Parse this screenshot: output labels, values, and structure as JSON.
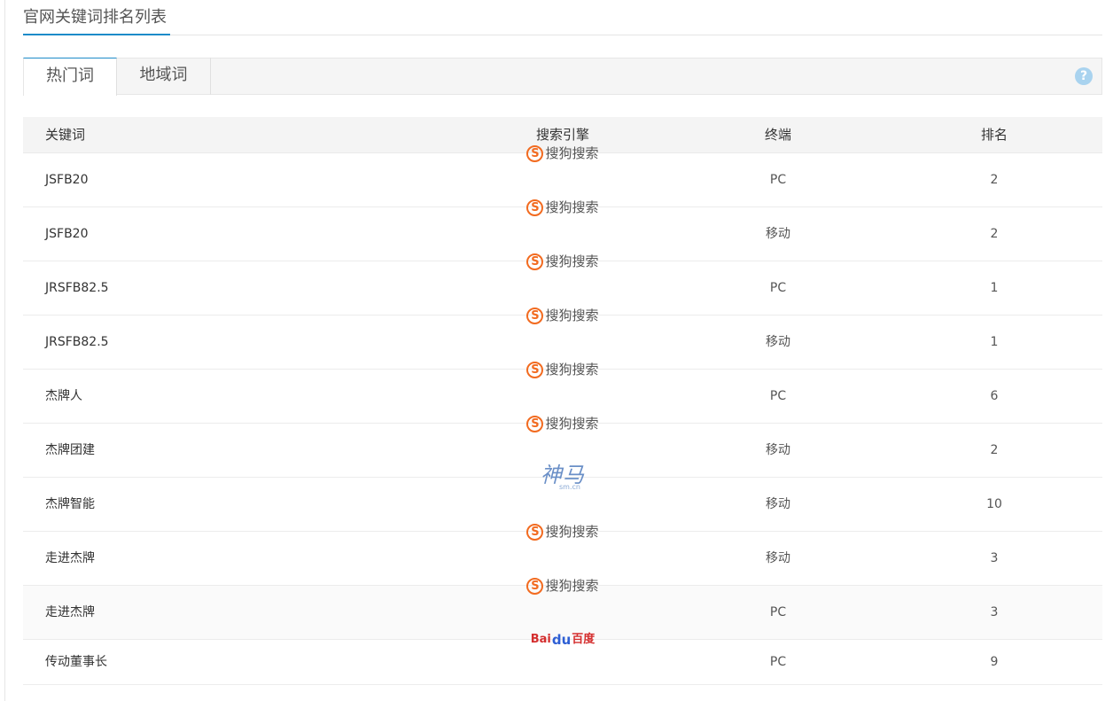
{
  "header": {
    "title": "官网关键词排名列表"
  },
  "tabs": [
    {
      "label": "热门词",
      "active": true
    },
    {
      "label": "地域词",
      "active": false
    }
  ],
  "help": {
    "glyph": "?"
  },
  "table": {
    "columns": [
      "关键词",
      "搜索引擎",
      "终端",
      "排名"
    ],
    "rows": [
      {
        "keyword": "JSFB20",
        "engine": "sogou",
        "engine_label": "搜狗搜索",
        "terminal": "PC",
        "rank": "2"
      },
      {
        "keyword": "JSFB20",
        "engine": "sogou",
        "engine_label": "搜狗搜索",
        "terminal": "移动",
        "rank": "2"
      },
      {
        "keyword": "JRSFB82.5",
        "engine": "sogou",
        "engine_label": "搜狗搜索",
        "terminal": "PC",
        "rank": "1"
      },
      {
        "keyword": "JRSFB82.5",
        "engine": "sogou",
        "engine_label": "搜狗搜索",
        "terminal": "移动",
        "rank": "1"
      },
      {
        "keyword": "杰牌人",
        "engine": "sogou",
        "engine_label": "搜狗搜索",
        "terminal": "PC",
        "rank": "6"
      },
      {
        "keyword": "杰牌团建",
        "engine": "sogou",
        "engine_label": "搜狗搜索",
        "terminal": "移动",
        "rank": "2"
      },
      {
        "keyword": "杰牌智能",
        "engine": "shenma",
        "engine_label": "神马",
        "engine_sub": "sm.cn",
        "terminal": "移动",
        "rank": "10"
      },
      {
        "keyword": "走进杰牌",
        "engine": "sogou",
        "engine_label": "搜狗搜索",
        "terminal": "移动",
        "rank": "3"
      },
      {
        "keyword": "走进杰牌",
        "engine": "sogou",
        "engine_label": "搜狗搜索",
        "terminal": "PC",
        "rank": "3"
      },
      {
        "keyword": "传动董事长",
        "engine": "baidu",
        "engine_label": "Bai百度",
        "engine_parts": [
          "Bai",
          "du",
          "百度"
        ],
        "terminal": "PC",
        "rank": "9"
      }
    ]
  },
  "colors": {
    "accent": "#1d8bc9",
    "sogou": "#f26b20",
    "shenma": "#6a8fc7",
    "baidu_red": "#d42e2e",
    "baidu_blue": "#2e5fd4"
  }
}
